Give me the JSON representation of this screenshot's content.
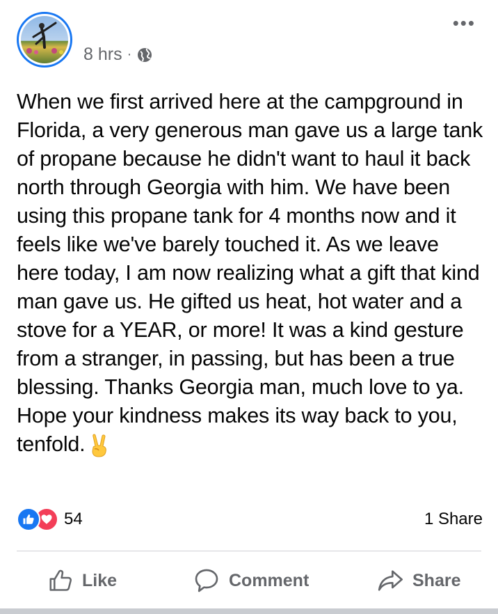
{
  "post": {
    "author_name": "",
    "time": "8 hrs",
    "separator": "·",
    "privacy_icon": "globe-icon",
    "more_icon": "more-horizontal-icon",
    "text": "When we first arrived here at the campground in Florida, a very generous man gave us a large tank of propane because he didn't want to haul it back north through Georgia with him. We have been using this propane tank for 4 months now and it feels like we've barely touched it. As we leave here today, I am now realizing what a gift that kind man gave us. He gifted us heat, hot water and a stove for a YEAR, or more! It was a kind gesture from a stranger, in passing, but has been a true blessing. Thanks Georgia man, much love to ya. Hope your kindness makes its way back to you, tenfold.",
    "emoji": "victory-hand"
  },
  "reactions": {
    "types": [
      "like",
      "love"
    ],
    "count": "54",
    "shares": "1 Share"
  },
  "actions": {
    "like_label": "Like",
    "comment_label": "Comment",
    "share_label": "Share"
  },
  "colors": {
    "accent": "#1877f2",
    "love": "#f33e58",
    "secondary_text": "#65676b",
    "divider": "#ced0d4"
  }
}
